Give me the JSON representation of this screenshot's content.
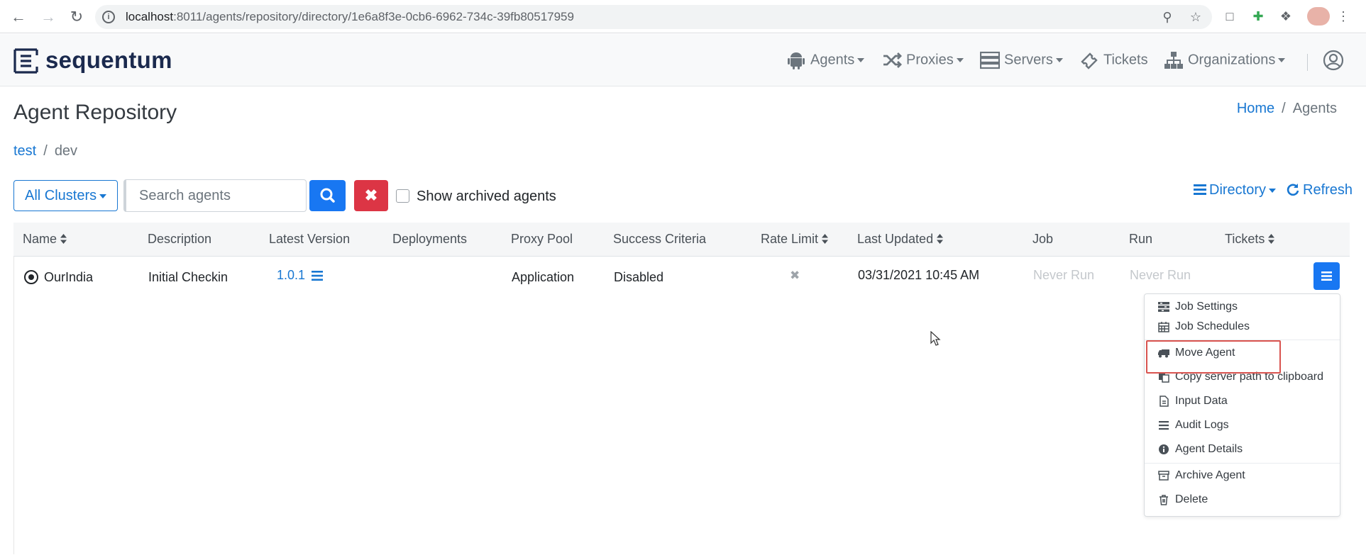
{
  "browser": {
    "url_host": "localhost",
    "url_rest": ":8011/agents/repository/directory/1e6a8f3e-0cb6-6962-734c-39fb80517959"
  },
  "brand": {
    "name": "sequentum",
    "color": "#1b2a4e"
  },
  "nav": {
    "items": [
      {
        "label": "Agents",
        "icon": "android-icon",
        "dropdown": true
      },
      {
        "label": "Proxies",
        "icon": "shuffle-icon",
        "dropdown": true
      },
      {
        "label": "Servers",
        "icon": "server-icon",
        "dropdown": true
      },
      {
        "label": "Tickets",
        "icon": "ticket-icon",
        "dropdown": false
      },
      {
        "label": "Organizations",
        "icon": "sitemap-icon",
        "dropdown": true
      }
    ]
  },
  "page": {
    "title": "Agent Repository",
    "breadcrumb": {
      "home": "Home",
      "current": "Agents"
    },
    "path": {
      "root": "test",
      "current": "dev"
    }
  },
  "toolbar": {
    "clusters_label": "All Clusters",
    "search_placeholder": "Search agents",
    "show_archived_label": "Show archived agents",
    "show_archived_checked": false,
    "directory_label": "Directory",
    "refresh_label": "Refresh"
  },
  "table": {
    "headers": {
      "name": "Name",
      "description": "Description",
      "latest_version": "Latest Version",
      "deployments": "Deployments",
      "proxy_pool": "Proxy Pool",
      "success_criteria": "Success Criteria",
      "rate_limit": "Rate Limit",
      "last_updated": "Last Updated",
      "job": "Job",
      "run": "Run",
      "tickets": "Tickets"
    },
    "rows": [
      {
        "name": "OurIndia",
        "description": "Initial Checkin",
        "latest_version": "1.0.1",
        "deployments": "",
        "proxy_pool": "Application",
        "success_criteria": "Disabled",
        "rate_limit": "✖",
        "last_updated": "03/31/2021 10:45 AM",
        "job": "Never Run",
        "run": "Never Run",
        "tickets": ""
      }
    ]
  },
  "row_menu": {
    "items": [
      {
        "label": "Job Settings",
        "icon": "settings-list-icon"
      },
      {
        "label": "Job Schedules",
        "icon": "calendar-icon"
      },
      {
        "label": "Move Agent",
        "icon": "truck-icon"
      },
      {
        "label": "Copy server path to clipboard",
        "icon": "copy-icon"
      },
      {
        "label": "Input Data",
        "icon": "file-icon"
      },
      {
        "label": "Audit Logs",
        "icon": "list-icon"
      },
      {
        "label": "Agent Details",
        "icon": "info-icon"
      },
      {
        "label": "Archive Agent",
        "icon": "archive-icon"
      },
      {
        "label": "Delete",
        "icon": "trash-icon"
      }
    ]
  },
  "colors": {
    "primary": "#1877f2",
    "link": "#1877d2",
    "danger": "#dc3545",
    "highlight": "#d9534f"
  }
}
